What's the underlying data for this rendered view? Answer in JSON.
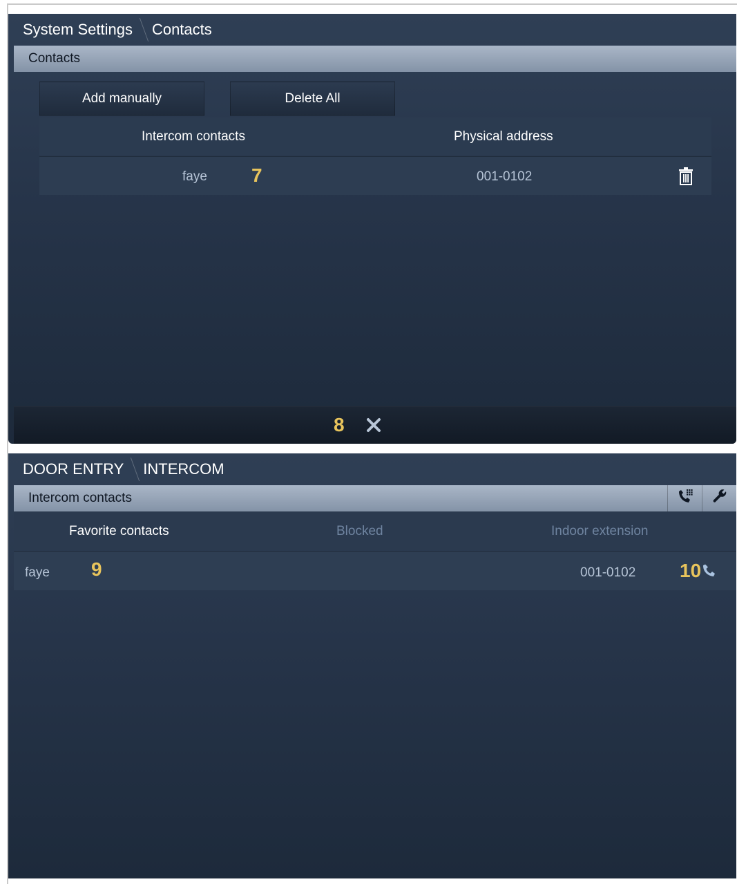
{
  "screen1": {
    "breadcrumb": [
      "System Settings",
      "Contacts"
    ],
    "section_title": "Contacts",
    "buttons": {
      "add_manually": "Add manually",
      "delete_all": "Delete All"
    },
    "columns": [
      "Intercom contacts",
      "Physical address"
    ],
    "rows": [
      {
        "name": "faye",
        "address": "001-0102",
        "action_icon": "trash-icon"
      }
    ],
    "bottom_close_icon": "close-icon"
  },
  "screen2": {
    "breadcrumb": [
      "DOOR ENTRY",
      "INTERCOM"
    ],
    "section_title": "Intercom contacts",
    "header_icons": [
      "phone-dialpad-icon",
      "wrench-icon"
    ],
    "tabs": [
      {
        "label": "Favorite contacts",
        "active": true
      },
      {
        "label": "Blocked",
        "active": false
      },
      {
        "label": "Indoor extension",
        "active": false
      }
    ],
    "rows": [
      {
        "name": "faye",
        "address": "001-0102",
        "action_icon": "phone-icon"
      }
    ]
  },
  "annotations": [
    "7",
    "8",
    "9",
    "10"
  ],
  "colors": {
    "annotation": "#e8c45c",
    "screen_bg": "#263449",
    "section_bar": "#98a6b8",
    "tab_inactive": "#6f84a0"
  }
}
